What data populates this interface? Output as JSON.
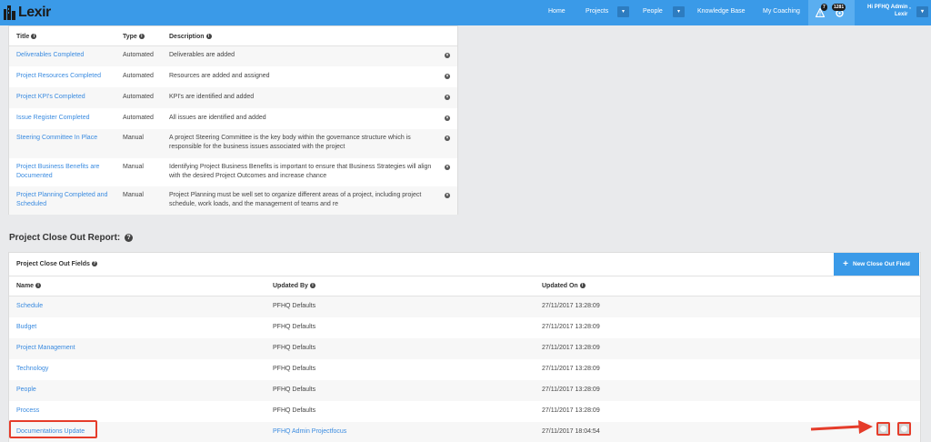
{
  "app": {
    "logo_text": "Lexir"
  },
  "nav": {
    "home": "Home",
    "projects": "Projects",
    "people": "People",
    "knowledge_base": "Knowledge Base",
    "my_coaching": "My Coaching",
    "help_badge": "7",
    "notif_badge": "1281",
    "user_greeting": "Hi PFHQ Admin ,",
    "user_org": "Lexir"
  },
  "milestones": {
    "headers": {
      "title": "Title",
      "type": "Type",
      "description": "Description"
    },
    "rows": [
      {
        "title": "Deliverables Completed",
        "type": "Automated",
        "description": "Deliverables are added"
      },
      {
        "title": "Project Resources Completed",
        "type": "Automated",
        "description": "Resources are added and assigned"
      },
      {
        "title": "Project KPI's Completed",
        "type": "Automated",
        "description": "KPI's are identified and added"
      },
      {
        "title": "Issue Register Completed",
        "type": "Automated",
        "description": "All issues are identified and added"
      },
      {
        "title": "Steering Committee In Place",
        "type": "Manual",
        "description": "A project Steering Committee is the key body within the governance structure which is responsible for the business issues associated with the project"
      },
      {
        "title": "Project Business Benefits are Documented",
        "type": "Manual",
        "description": "Identifying Project Business Benefits is important to ensure that Business Strategies will align with the desired Project Outcomes and increase chance"
      },
      {
        "title": "Project Planning Completed and Scheduled",
        "type": "Manual",
        "description": "Project Planning must be well set to organize different areas of a project, including project schedule, work loads, and the management of teams and re"
      }
    ]
  },
  "close_out": {
    "section_title": "Project Close Out Report:",
    "panel_title": "Project Close Out Fields",
    "new_button": "New Close Out Field",
    "headers": {
      "name": "Name",
      "updated_by": "Updated By",
      "updated_on": "Updated On"
    },
    "rows": [
      {
        "name": "Schedule",
        "updated_by": "PFHQ Defaults",
        "updated_on": "27/11/2017 13:28:09"
      },
      {
        "name": "Budget",
        "updated_by": "PFHQ Defaults",
        "updated_on": "27/11/2017 13:28:09"
      },
      {
        "name": "Project Management",
        "updated_by": "PFHQ Defaults",
        "updated_on": "27/11/2017 13:28:09"
      },
      {
        "name": "Technology",
        "updated_by": "PFHQ Defaults",
        "updated_on": "27/11/2017 13:28:09"
      },
      {
        "name": "People",
        "updated_by": "PFHQ Defaults",
        "updated_on": "27/11/2017 13:28:09"
      },
      {
        "name": "Process",
        "updated_by": "PFHQ Defaults",
        "updated_on": "27/11/2017 13:28:09"
      },
      {
        "name": "Documentations Update",
        "updated_by": "PFHQ Admin Projectfocus",
        "updated_on": "27/11/2017 18:04:54"
      }
    ]
  },
  "colors": {
    "accent": "#3a9ae8",
    "link": "#3a8be0",
    "annotation": "#e53c2a"
  }
}
